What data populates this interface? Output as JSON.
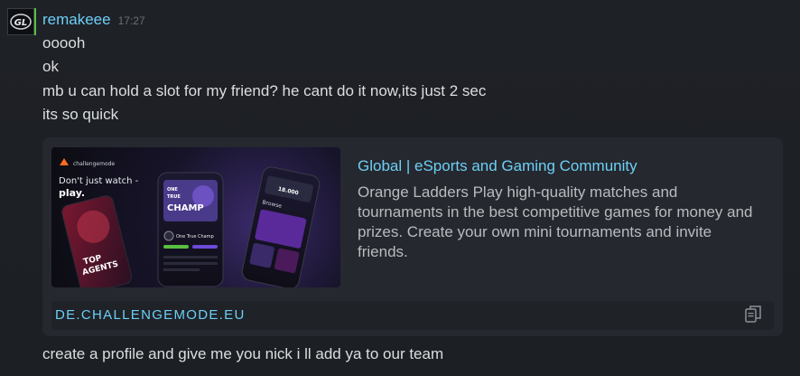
{
  "message": {
    "author": "remakeee",
    "time": "17:27",
    "avatar_text": "GL",
    "lines": [
      "ooooh",
      "ok",
      "mb u can hold a slot for my friend? he cant do it now,its just 2 sec",
      "its so quick"
    ],
    "last_line": "create a profile and give me you nick i ll add ya to our team"
  },
  "embed": {
    "title": "Global | eSports and Gaming Community",
    "description": "Orange Ladders Play high-quality matches and tournaments in the best competitive games for money and prizes. Create your own mini tournaments and invite friends.",
    "url": "DE.CHALLENGEMODE.EU",
    "copy_icon": "copy-icon",
    "thumbnail": {
      "brand": "challengemode",
      "tagline": "Don't just watch -",
      "tagline2": "play.",
      "promo1": "TOP",
      "promo2": "AGENTS",
      "phone_title1": "ONE",
      "phone_title2": "TRUE",
      "phone_title3": "CHAMP",
      "phone_label": "One True Champ",
      "browse": "Browse",
      "score": "18.000"
    }
  },
  "colors": {
    "accent": "#6dcff6",
    "online": "#59bf40",
    "brand_orange": "#ff6a1f",
    "purple": "#6c4bd9"
  }
}
